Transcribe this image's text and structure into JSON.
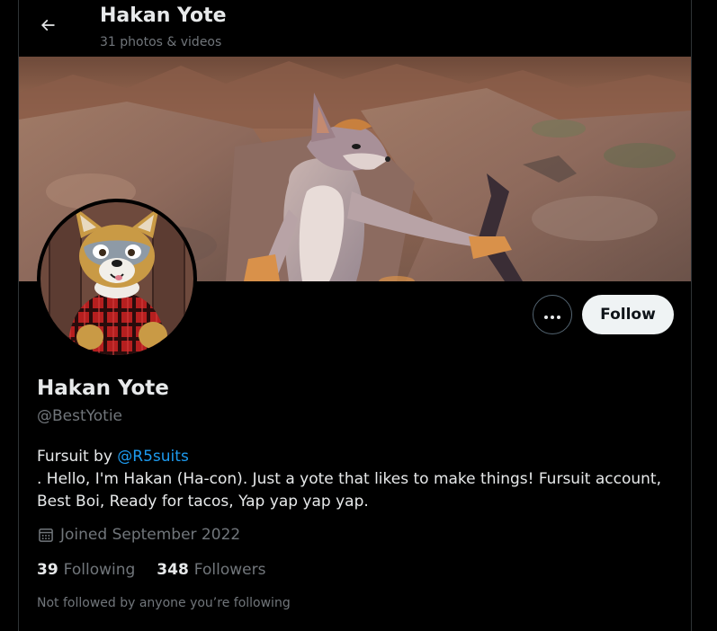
{
  "header": {
    "title": "Hakan Yote",
    "subtitle": "31 photos & videos"
  },
  "profile": {
    "display_name": "Hakan Yote",
    "handle": "@BestYotie",
    "bio_prefix": "Fursuit by ",
    "bio_link": "@R5suits",
    "bio_line2": ". Hello, I'm Hakan (Ha-con). Just a yote that likes to make things! Fursuit account,",
    "bio_line3": "Best Boi, Ready for tacos, Yap yap yap yap.",
    "joined": "Joined September 2022",
    "following_count": "39",
    "following_label": "Following",
    "followers_count": "348",
    "followers_label": "Followers",
    "not_followed_note": "Not followed by anyone you’re following"
  },
  "actions": {
    "follow_label": "Follow"
  },
  "icons": {
    "back": "arrow-left-icon",
    "more": "more-dots-icon",
    "calendar": "calendar-icon"
  },
  "colors": {
    "background": "#000000",
    "text_primary": "#e7e9ea",
    "text_secondary": "#71767b",
    "link": "#1d9bf0",
    "follow_button_bg": "#eff3f4",
    "border": "#2f3336"
  }
}
